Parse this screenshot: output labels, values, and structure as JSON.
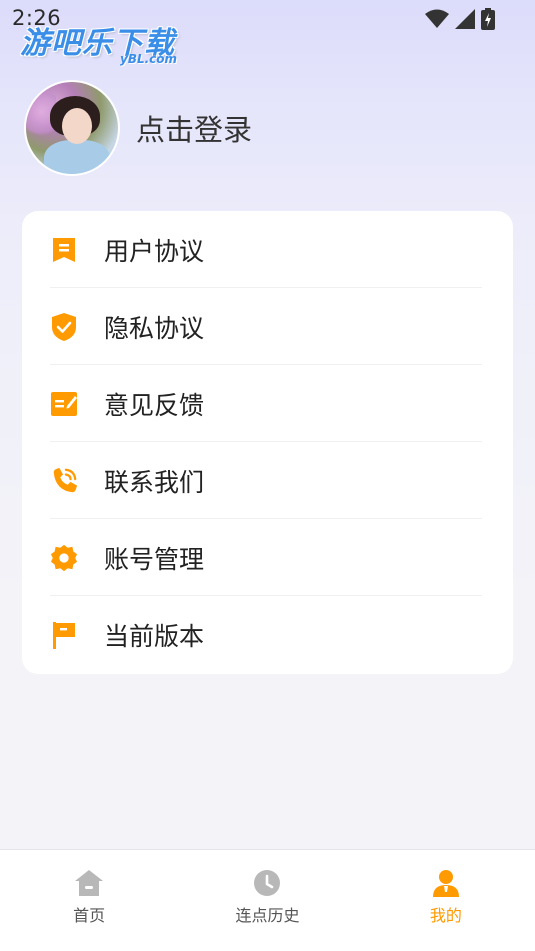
{
  "status_bar": {
    "time": "2:26",
    "icons": [
      "wifi-icon",
      "signal-icon",
      "battery-icon"
    ]
  },
  "watermark": {
    "main": "游吧乐下载",
    "sub": "yBL.com"
  },
  "profile": {
    "login_label": "点击登录",
    "avatar": "avatar-photo"
  },
  "menu": {
    "items": [
      {
        "label": "用户协议",
        "icon": "document-icon"
      },
      {
        "label": "隐私协议",
        "icon": "shield-check-icon"
      },
      {
        "label": "意见反馈",
        "icon": "feedback-icon"
      },
      {
        "label": "联系我们",
        "icon": "phone-icon"
      },
      {
        "label": "账号管理",
        "icon": "gear-icon"
      },
      {
        "label": "当前版本",
        "icon": "flag-icon"
      }
    ]
  },
  "tabbar": {
    "tabs": [
      {
        "label": "首页",
        "icon": "home-icon",
        "active": false
      },
      {
        "label": "连点历史",
        "icon": "clock-icon",
        "active": false
      },
      {
        "label": "我的",
        "icon": "profile-icon",
        "active": true
      }
    ]
  },
  "colors": {
    "accent": "#ff9a00",
    "inactive_icon": "#b8b8b8"
  }
}
